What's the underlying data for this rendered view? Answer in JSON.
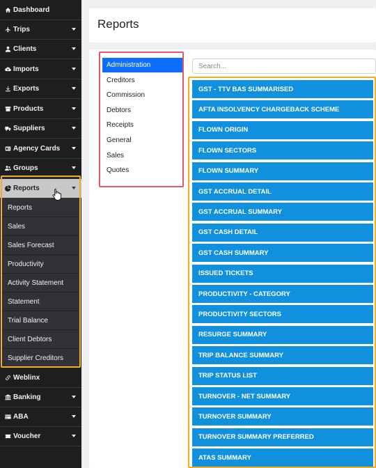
{
  "sidebar": {
    "items": [
      {
        "label": "Dashboard",
        "icon": "home-icon",
        "caret": false
      },
      {
        "label": "Trips",
        "icon": "plane-icon",
        "caret": true
      },
      {
        "label": "Clients",
        "icon": "user-icon",
        "caret": true
      },
      {
        "label": "Imports",
        "icon": "cloud-upload-icon",
        "caret": true
      },
      {
        "label": "Exports",
        "icon": "download-icon",
        "caret": true
      },
      {
        "label": "Products",
        "icon": "box-icon",
        "caret": true
      },
      {
        "label": "Suppliers",
        "icon": "truck-icon",
        "caret": true
      },
      {
        "label": "Agency Cards",
        "icon": "id-card-icon",
        "caret": true
      },
      {
        "label": "Groups",
        "icon": "users-icon",
        "caret": true
      },
      {
        "label": "Reports",
        "icon": "pie-chart-icon",
        "caret": true,
        "active": true
      },
      {
        "label": "Weblinx",
        "icon": "link-icon",
        "caret": false
      },
      {
        "label": "Banking",
        "icon": "bank-icon",
        "caret": true
      },
      {
        "label": "ABA",
        "icon": "credit-card-icon",
        "caret": true
      },
      {
        "label": "Voucher",
        "icon": "ticket-icon",
        "caret": true
      }
    ],
    "reports_submenu": [
      "Reports",
      "Sales",
      "Sales Forecast",
      "Productivity",
      "Activity Statement",
      "Statement",
      "Trial Balance",
      "Client Debtors",
      "Supplier Creditors"
    ]
  },
  "header": {
    "title": "Reports"
  },
  "categories": {
    "items": [
      "Administration",
      "Creditors",
      "Commission",
      "Debtors",
      "Receipts",
      "General",
      "Sales",
      "Quotes"
    ],
    "selected": "Administration"
  },
  "search": {
    "placeholder": "Search...",
    "value": ""
  },
  "reports": [
    "GST - TTV BAS SUMMARISED",
    "AFTA INSOLVENCY CHARGEBACK SCHEME",
    "FLOWN ORIGIN",
    "FLOWN SECTORS",
    "FLOWN SUMMARY",
    "GST ACCRUAL DETAIL",
    "GST ACCRUAL SUMMARY",
    "GST CASH DETAIL",
    "GST CASH SUMMARY",
    "ISSUED TICKETS",
    "PRODUCTIVITY - CATEGORY",
    "PRODUCTIVITY SECTORS",
    "RESURGE SUMMARY",
    "TRIP BALANCE SUMMARY",
    "TRIP STATUS LIST",
    "TURNOVER - NET SUMMARY",
    "TURNOVER SUMMARY",
    "TURNOVER SUMMARY PREFERRED",
    "ATAS SUMMARY"
  ],
  "colors": {
    "sidebar_bg": "#1d1e20",
    "submenu_bg": "#303236",
    "active_item_bg": "#c6c8ca",
    "report_button": "#1191dd",
    "selected_category": "#0d6efd",
    "highlight_orange": "#f3ad2d",
    "highlight_red": "#e8556a"
  }
}
